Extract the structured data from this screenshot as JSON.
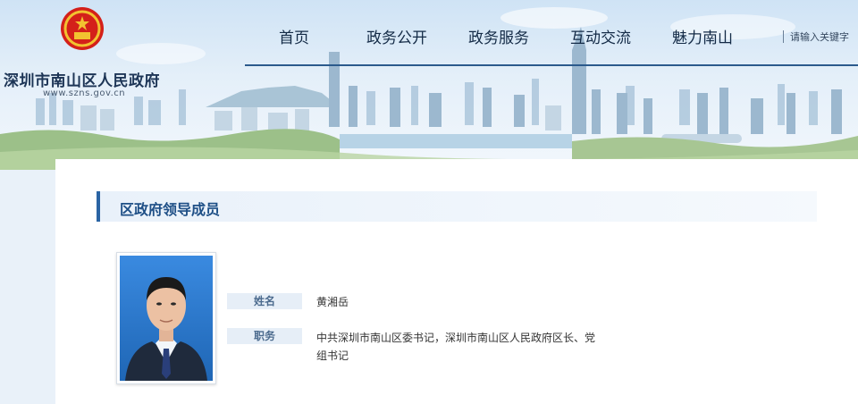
{
  "header": {
    "site_name": "深圳市南山区人民政府",
    "site_url": "www.szns.gov.cn",
    "emblem_icon": "national-emblem-icon"
  },
  "nav": {
    "items": [
      "首页",
      "政务公开",
      "政务服务",
      "互动交流",
      "魅力南山"
    ],
    "search_placeholder": "请输入关键字"
  },
  "section": {
    "title": "区政府领导成员"
  },
  "leader": {
    "name_label": "姓名",
    "name": "黄湘岳",
    "position_label": "职务",
    "position_line1": "中共深圳市南山区委书记，深圳市南山区人民政府区长、党",
    "position_line2": "组书记"
  },
  "colors": {
    "accent": "#2a64a4",
    "title_text": "#1e4f86",
    "nav_text": "#132a46",
    "label_bg": "#e6eef7"
  }
}
